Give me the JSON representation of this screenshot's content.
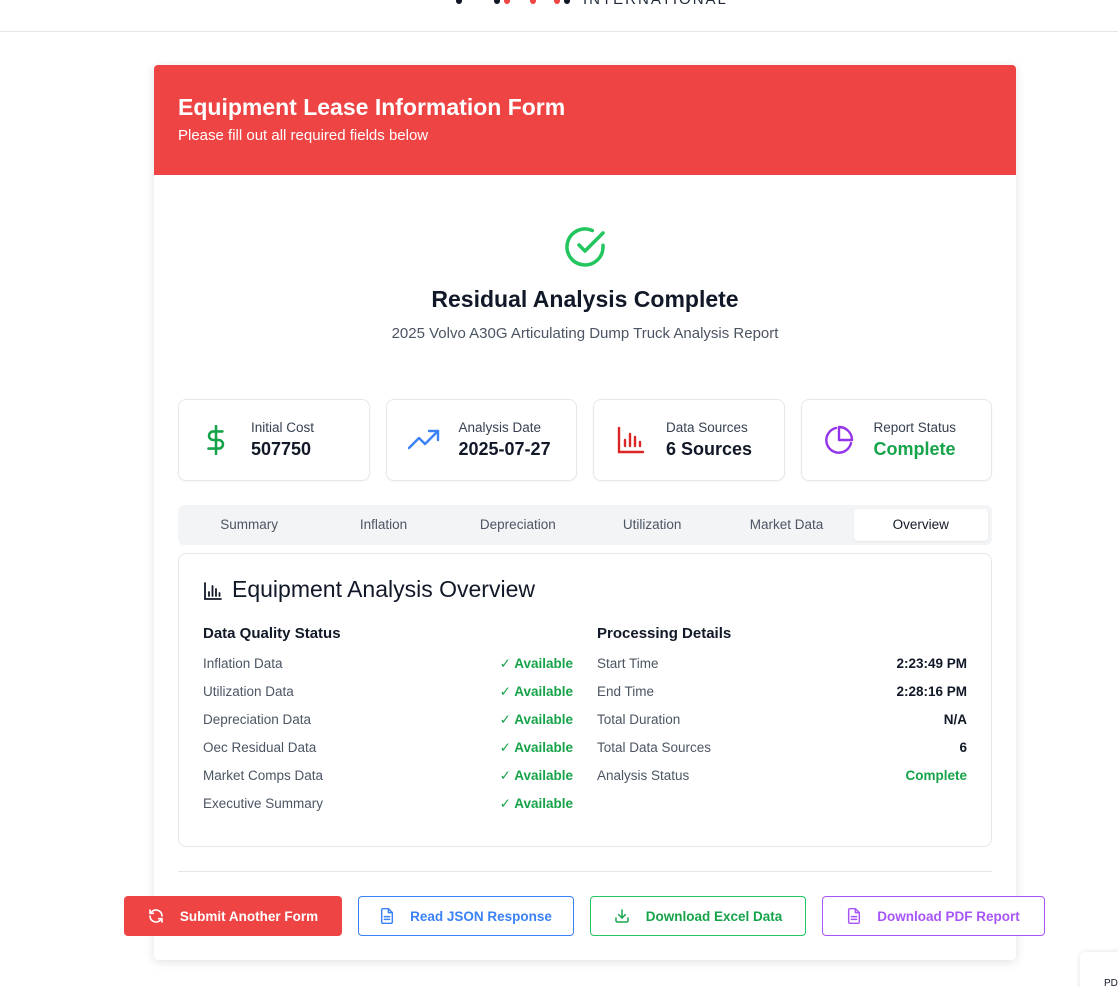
{
  "brand": {
    "logo_text": "INTERNATIONAL",
    "mark_colors": [
      "#111827",
      "#111827",
      "#ef4444",
      "#ef4444",
      "#ef4444",
      "#ef4444",
      "#111827"
    ]
  },
  "form": {
    "title": "Equipment Lease Information Form",
    "subtitle": "Please fill out all required fields below",
    "header_color": "#ef4444"
  },
  "result": {
    "icon": "check-circle-icon",
    "title": "Residual Analysis Complete",
    "subtitle": "2025 Volvo A30G Articulating Dump Truck Analysis Report"
  },
  "stats": [
    {
      "label": "Initial Cost",
      "value": "507750",
      "icon": "dollar-icon",
      "color": "#16a34a"
    },
    {
      "label": "Analysis Date",
      "value": "2025-07-27",
      "icon": "trending-up-icon",
      "color": "#3b82f6"
    },
    {
      "label": "Data Sources",
      "value": "6 Sources",
      "icon": "bar-chart-icon",
      "color": "#dc2626"
    },
    {
      "label": "Report Status",
      "value": "Complete",
      "icon": "pie-chart-icon",
      "color": "#9333ea"
    }
  ],
  "tabs": [
    {
      "label": "Summary",
      "active": false
    },
    {
      "label": "Inflation",
      "active": false
    },
    {
      "label": "Depreciation",
      "active": false
    },
    {
      "label": "Utilization",
      "active": false
    },
    {
      "label": "Market Data",
      "active": false
    },
    {
      "label": "Overview",
      "active": true
    }
  ],
  "overview": {
    "title": "Equipment Analysis Overview",
    "icon": "bar-chart-icon",
    "quality": {
      "heading": "Data Quality Status",
      "rows": [
        {
          "label": "Inflation Data",
          "value": "✓ Available"
        },
        {
          "label": "Utilization Data",
          "value": "✓ Available"
        },
        {
          "label": "Depreciation Data",
          "value": "✓ Available"
        },
        {
          "label": "Oec Residual Data",
          "value": "✓ Available"
        },
        {
          "label": "Market Comps Data",
          "value": "✓ Available"
        },
        {
          "label": "Executive Summary",
          "value": "✓ Available"
        }
      ]
    },
    "processing": {
      "heading": "Processing Details",
      "rows": [
        {
          "label": "Start Time",
          "value": "2:23:49 PM"
        },
        {
          "label": "End Time",
          "value": "2:28:16 PM"
        },
        {
          "label": "Total Duration",
          "value": "N/A"
        },
        {
          "label": "Total Data Sources",
          "value": "6"
        },
        {
          "label": "Analysis Status",
          "value": "Complete"
        }
      ]
    }
  },
  "actions": {
    "submit_another": "Submit Another Form",
    "read_json": "Read JSON Response",
    "download_excel": "Download Excel Data",
    "download_pdf": "Download PDF Report"
  },
  "corner_label": "PD"
}
